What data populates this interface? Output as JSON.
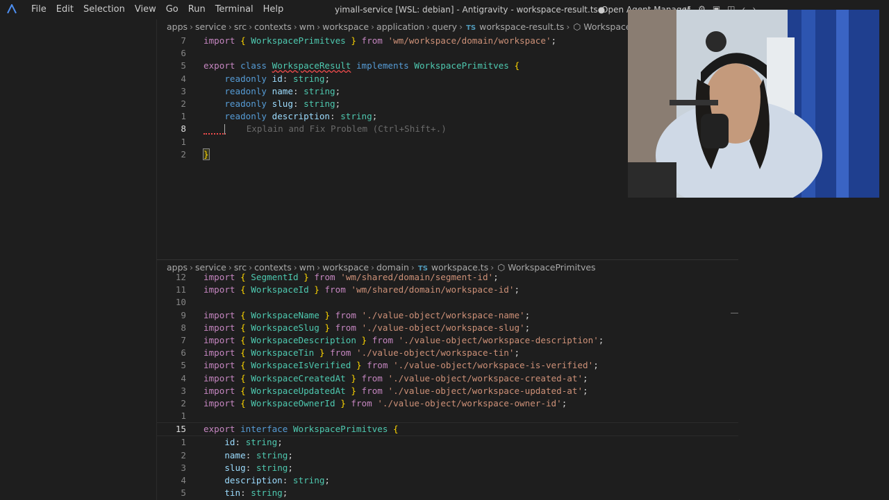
{
  "window": {
    "title": "yimall-service [WSL: debian] - Antigravity - workspace-result.ts●",
    "agent_manager_label": "Open Agent Manager"
  },
  "menu": [
    "File",
    "Edit",
    "Selection",
    "View",
    "Go",
    "Run",
    "Terminal",
    "Help"
  ],
  "editor_top": {
    "breadcrumb": [
      "apps",
      "service",
      "src",
      "contexts",
      "wm",
      "workspace",
      "application",
      "query"
    ],
    "file": "workspace-result.ts",
    "symbol": "WorkspaceResu",
    "file_icon": "TS",
    "lines": [
      {
        "n": "7",
        "tokens": [
          [
            "kw",
            "import"
          ],
          [
            "pu",
            " "
          ],
          [
            "br",
            "{"
          ],
          [
            "pu",
            " "
          ],
          [
            "cl",
            "WorkspacePrimitves"
          ],
          [
            "pu",
            " "
          ],
          [
            "br",
            "}"
          ],
          [
            "pu",
            " "
          ],
          [
            "kw",
            "from"
          ],
          [
            "pu",
            " "
          ],
          [
            "st",
            "'wm/workspace/domain/workspace'"
          ],
          [
            "pu",
            ";"
          ]
        ]
      },
      {
        "n": "6",
        "tokens": []
      },
      {
        "n": "5",
        "tokens": [
          [
            "kw",
            "export"
          ],
          [
            "pu",
            " "
          ],
          [
            "kb",
            "class"
          ],
          [
            "pu",
            " "
          ],
          [
            "cl squig",
            "WorkspaceResult"
          ],
          [
            "pu",
            " "
          ],
          [
            "kb",
            "implements"
          ],
          [
            "pu",
            " "
          ],
          [
            "cl",
            "WorkspacePrimitves"
          ],
          [
            "pu",
            " "
          ],
          [
            "br",
            "{"
          ]
        ]
      },
      {
        "n": "4",
        "tokens": [
          [
            "pu",
            "    "
          ],
          [
            "kb",
            "readonly"
          ],
          [
            "pu",
            " "
          ],
          [
            "pr",
            "id"
          ],
          [
            "pu",
            ": "
          ],
          [
            "ty",
            "string"
          ],
          [
            "pu",
            ";"
          ]
        ]
      },
      {
        "n": "3",
        "tokens": [
          [
            "pu",
            "    "
          ],
          [
            "kb",
            "readonly"
          ],
          [
            "pu",
            " "
          ],
          [
            "pr",
            "name"
          ],
          [
            "pu",
            ": "
          ],
          [
            "ty",
            "string"
          ],
          [
            "pu",
            ";"
          ]
        ]
      },
      {
        "n": "2",
        "tokens": [
          [
            "pu",
            "    "
          ],
          [
            "kb",
            "readonly"
          ],
          [
            "pu",
            " "
          ],
          [
            "pr",
            "slug"
          ],
          [
            "pu",
            ": "
          ],
          [
            "ty",
            "string"
          ],
          [
            "pu",
            ";"
          ]
        ]
      },
      {
        "n": "1",
        "tokens": [
          [
            "pu",
            "    "
          ],
          [
            "kb",
            "readonly"
          ],
          [
            "pu",
            " "
          ],
          [
            "pr",
            "description"
          ],
          [
            "pu",
            ": "
          ],
          [
            "ty",
            "string"
          ],
          [
            "pu",
            ";"
          ]
        ]
      },
      {
        "n": "8",
        "active": true,
        "cursor": true,
        "ghost": "Explain and Fix Problem (Ctrl+Shift+.)"
      },
      {
        "n": "1",
        "tokens": []
      },
      {
        "n": "2",
        "tokens": [
          [
            "br",
            "}"
          ]
        ],
        "brace": true
      }
    ]
  },
  "editor_bottom": {
    "breadcrumb": [
      "apps",
      "service",
      "src",
      "contexts",
      "wm",
      "workspace",
      "domain"
    ],
    "file": "workspace.ts",
    "symbol": "WorkspacePrimitves",
    "file_icon": "TS",
    "lines": [
      {
        "n": "12",
        "tokens": [
          [
            "kw",
            "import"
          ],
          [
            "pu",
            " "
          ],
          [
            "br",
            "{"
          ],
          [
            "pu",
            " "
          ],
          [
            "cl",
            "SegmentId"
          ],
          [
            "pu",
            " "
          ],
          [
            "br",
            "}"
          ],
          [
            "pu",
            " "
          ],
          [
            "kw",
            "from"
          ],
          [
            "pu",
            " "
          ],
          [
            "st",
            "'wm/shared/domain/segment-id'"
          ],
          [
            "pu",
            ";"
          ]
        ]
      },
      {
        "n": "11",
        "tokens": [
          [
            "kw",
            "import"
          ],
          [
            "pu",
            " "
          ],
          [
            "br",
            "{"
          ],
          [
            "pu",
            " "
          ],
          [
            "cl",
            "WorkspaceId"
          ],
          [
            "pu",
            " "
          ],
          [
            "br",
            "}"
          ],
          [
            "pu",
            " "
          ],
          [
            "kw",
            "from"
          ],
          [
            "pu",
            " "
          ],
          [
            "st",
            "'wm/shared/domain/workspace-id'"
          ],
          [
            "pu",
            ";"
          ]
        ]
      },
      {
        "n": "10",
        "tokens": []
      },
      {
        "n": "9",
        "tokens": [
          [
            "kw",
            "import"
          ],
          [
            "pu",
            " "
          ],
          [
            "br",
            "{"
          ],
          [
            "pu",
            " "
          ],
          [
            "cl",
            "WorkspaceName"
          ],
          [
            "pu",
            " "
          ],
          [
            "br",
            "}"
          ],
          [
            "pu",
            " "
          ],
          [
            "kw",
            "from"
          ],
          [
            "pu",
            " "
          ],
          [
            "st",
            "'./value-object/workspace-name'"
          ],
          [
            "pu",
            ";"
          ]
        ]
      },
      {
        "n": "8",
        "tokens": [
          [
            "kw",
            "import"
          ],
          [
            "pu",
            " "
          ],
          [
            "br",
            "{"
          ],
          [
            "pu",
            " "
          ],
          [
            "cl",
            "WorkspaceSlug"
          ],
          [
            "pu",
            " "
          ],
          [
            "br",
            "}"
          ],
          [
            "pu",
            " "
          ],
          [
            "kw",
            "from"
          ],
          [
            "pu",
            " "
          ],
          [
            "st",
            "'./value-object/workspace-slug'"
          ],
          [
            "pu",
            ";"
          ]
        ]
      },
      {
        "n": "7",
        "tokens": [
          [
            "kw",
            "import"
          ],
          [
            "pu",
            " "
          ],
          [
            "br",
            "{"
          ],
          [
            "pu",
            " "
          ],
          [
            "cl",
            "WorkspaceDescription"
          ],
          [
            "pu",
            " "
          ],
          [
            "br",
            "}"
          ],
          [
            "pu",
            " "
          ],
          [
            "kw",
            "from"
          ],
          [
            "pu",
            " "
          ],
          [
            "st",
            "'./value-object/workspace-description'"
          ],
          [
            "pu",
            ";"
          ]
        ]
      },
      {
        "n": "6",
        "tokens": [
          [
            "kw",
            "import"
          ],
          [
            "pu",
            " "
          ],
          [
            "br",
            "{"
          ],
          [
            "pu",
            " "
          ],
          [
            "cl",
            "WorkspaceTin"
          ],
          [
            "pu",
            " "
          ],
          [
            "br",
            "}"
          ],
          [
            "pu",
            " "
          ],
          [
            "kw",
            "from"
          ],
          [
            "pu",
            " "
          ],
          [
            "st",
            "'./value-object/workspace-tin'"
          ],
          [
            "pu",
            ";"
          ]
        ]
      },
      {
        "n": "5",
        "tokens": [
          [
            "kw",
            "import"
          ],
          [
            "pu",
            " "
          ],
          [
            "br",
            "{"
          ],
          [
            "pu",
            " "
          ],
          [
            "cl",
            "WorkspaceIsVerified"
          ],
          [
            "pu",
            " "
          ],
          [
            "br",
            "}"
          ],
          [
            "pu",
            " "
          ],
          [
            "kw",
            "from"
          ],
          [
            "pu",
            " "
          ],
          [
            "st",
            "'./value-object/workspace-is-verified'"
          ],
          [
            "pu",
            ";"
          ]
        ]
      },
      {
        "n": "4",
        "tokens": [
          [
            "kw",
            "import"
          ],
          [
            "pu",
            " "
          ],
          [
            "br",
            "{"
          ],
          [
            "pu",
            " "
          ],
          [
            "cl",
            "WorkspaceCreatedAt"
          ],
          [
            "pu",
            " "
          ],
          [
            "br",
            "}"
          ],
          [
            "pu",
            " "
          ],
          [
            "kw",
            "from"
          ],
          [
            "pu",
            " "
          ],
          [
            "st",
            "'./value-object/workspace-created-at'"
          ],
          [
            "pu",
            ";"
          ]
        ]
      },
      {
        "n": "3",
        "tokens": [
          [
            "kw",
            "import"
          ],
          [
            "pu",
            " "
          ],
          [
            "br",
            "{"
          ],
          [
            "pu",
            " "
          ],
          [
            "cl",
            "WorkspaceUpdatedAt"
          ],
          [
            "pu",
            " "
          ],
          [
            "br",
            "}"
          ],
          [
            "pu",
            " "
          ],
          [
            "kw",
            "from"
          ],
          [
            "pu",
            " "
          ],
          [
            "st",
            "'./value-object/workspace-updated-at'"
          ],
          [
            "pu",
            ";"
          ]
        ]
      },
      {
        "n": "2",
        "tokens": [
          [
            "kw",
            "import"
          ],
          [
            "pu",
            " "
          ],
          [
            "br",
            "{"
          ],
          [
            "pu",
            " "
          ],
          [
            "cl",
            "WorkspaceOwnerId"
          ],
          [
            "pu",
            " "
          ],
          [
            "br",
            "}"
          ],
          [
            "pu",
            " "
          ],
          [
            "kw",
            "from"
          ],
          [
            "pu",
            " "
          ],
          [
            "st",
            "'./value-object/workspace-owner-id'"
          ],
          [
            "pu",
            ";"
          ]
        ]
      },
      {
        "n": "1",
        "tokens": []
      },
      {
        "n": "15",
        "active": true,
        "current": true,
        "tokens": [
          [
            "kw",
            "export"
          ],
          [
            "pu",
            " "
          ],
          [
            "kb",
            "interface"
          ],
          [
            "pu",
            " "
          ],
          [
            "cl",
            "WorkspacePrimitves"
          ],
          [
            "pu",
            " "
          ],
          [
            "br",
            "{"
          ]
        ]
      },
      {
        "n": "1",
        "tokens": [
          [
            "pu",
            "    "
          ],
          [
            "pr",
            "id"
          ],
          [
            "pu",
            ": "
          ],
          [
            "ty",
            "string"
          ],
          [
            "pu",
            ";"
          ]
        ]
      },
      {
        "n": "2",
        "tokens": [
          [
            "pu",
            "    "
          ],
          [
            "pr",
            "name"
          ],
          [
            "pu",
            ": "
          ],
          [
            "ty",
            "string"
          ],
          [
            "pu",
            ";"
          ]
        ]
      },
      {
        "n": "3",
        "tokens": [
          [
            "pu",
            "    "
          ],
          [
            "pr",
            "slug"
          ],
          [
            "pu",
            ": "
          ],
          [
            "ty",
            "string"
          ],
          [
            "pu",
            ";"
          ]
        ]
      },
      {
        "n": "4",
        "tokens": [
          [
            "pu",
            "    "
          ],
          [
            "pr",
            "description"
          ],
          [
            "pu",
            ": "
          ],
          [
            "ty",
            "string"
          ],
          [
            "pu",
            ";"
          ]
        ]
      },
      {
        "n": "5",
        "tokens": [
          [
            "pu",
            "    "
          ],
          [
            "pr",
            "tin"
          ],
          [
            "pu",
            ": "
          ],
          [
            "ty",
            "string"
          ],
          [
            "pu",
            ";"
          ]
        ]
      }
    ]
  }
}
